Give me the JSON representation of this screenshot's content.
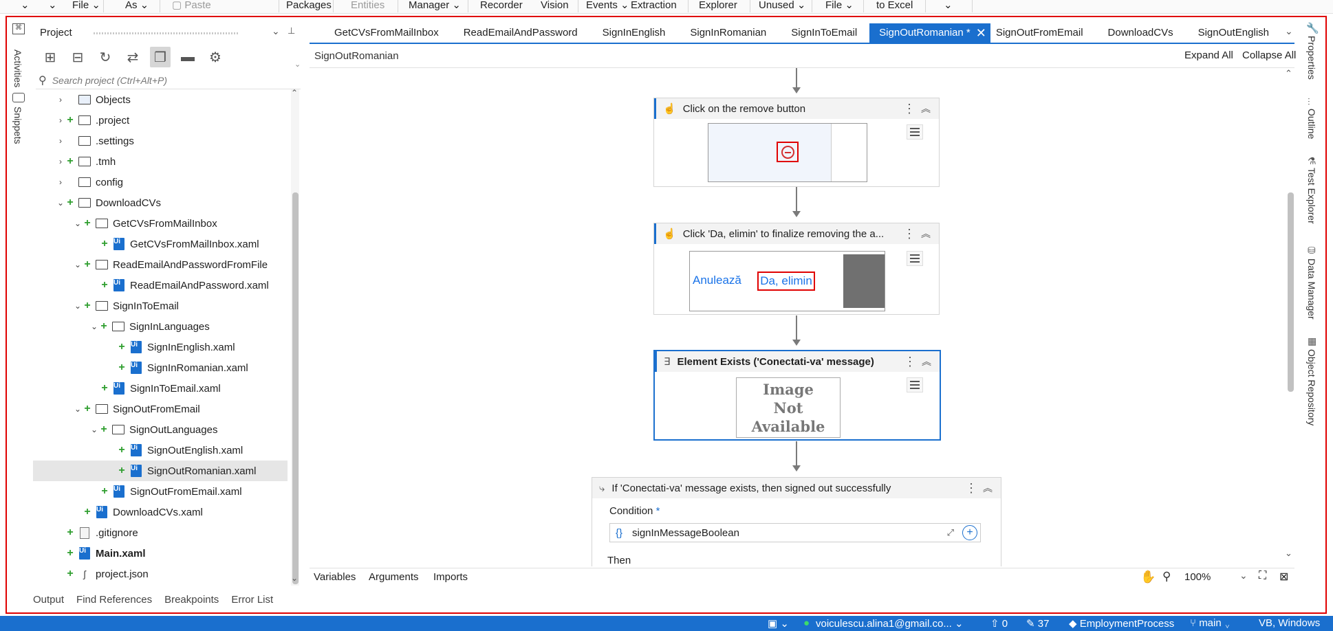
{
  "ribbon": {
    "items": [
      "File",
      "As",
      "Paste",
      "Packages",
      "Entities",
      "Manager",
      "Recorder",
      "Vision",
      "Events",
      "Extraction",
      "Explorer",
      "Unused",
      "File",
      "to Excel"
    ]
  },
  "left_rail": {
    "activities": "Activities",
    "snippets": "Snippets"
  },
  "project_panel": {
    "title": "Project",
    "search_placeholder": "Search project (Ctrl+Alt+P)",
    "tree": [
      {
        "label": "Objects"
      },
      {
        "label": ".project"
      },
      {
        "label": ".settings"
      },
      {
        "label": ".tmh"
      },
      {
        "label": "config"
      },
      {
        "label": "DownloadCVs"
      },
      {
        "label": "GetCVsFromMailInbox"
      },
      {
        "label": "GetCVsFromMailInbox.xaml"
      },
      {
        "label": "ReadEmailAndPasswordFromFile"
      },
      {
        "label": "ReadEmailAndPassword.xaml"
      },
      {
        "label": "SignInToEmail"
      },
      {
        "label": "SignInLanguages"
      },
      {
        "label": "SignInEnglish.xaml"
      },
      {
        "label": "SignInRomanian.xaml"
      },
      {
        "label": "SignInToEmail.xaml"
      },
      {
        "label": "SignOutFromEmail"
      },
      {
        "label": "SignOutLanguages"
      },
      {
        "label": "SignOutEnglish.xaml"
      },
      {
        "label": "SignOutRomanian.xaml"
      },
      {
        "label": "SignOutFromEmail.xaml"
      },
      {
        "label": "DownloadCVs.xaml"
      },
      {
        "label": ".gitignore"
      },
      {
        "label": "Main.xaml"
      },
      {
        "label": "project.json"
      }
    ]
  },
  "bottom_tabs": [
    "Output",
    "Find References",
    "Breakpoints",
    "Error List"
  ],
  "doc_tabs": [
    "GetCVsFromMailInbox",
    "ReadEmailAndPassword",
    "SignInEnglish",
    "SignInRomanian",
    "SignInToEmail",
    "SignOutRomanian *",
    "SignOutFromEmail",
    "DownloadCVs",
    "SignOutEnglish"
  ],
  "designer": {
    "breadcrumb": "SignOutRomanian",
    "expand_all": "Expand All",
    "collapse_all": "Collapse All",
    "activities": [
      {
        "title": "Click on the remove button"
      },
      {
        "title": "Click 'Da, elimin' to finalize removing the a..."
      },
      {
        "title": "Element Exists ('Conectati-va' message)"
      },
      {
        "title": "If 'Conectati-va' message exists, then signed out successfully"
      }
    ],
    "cancel_text": "Anulează",
    "confirm_text": "Da, elimin",
    "image_unavailable": [
      "Image",
      "Not",
      "Available"
    ],
    "condition_label": "Condition",
    "condition_required": "*",
    "condition_value": "signInMessageBoolean",
    "then_label": "Then",
    "bottom_tabs": [
      "Variables",
      "Arguments",
      "Imports"
    ],
    "zoom": "100%"
  },
  "right_rail": [
    "Properties",
    "Outline",
    "Test Explorer",
    "Data Manager",
    "Object Repository"
  ],
  "status_bar": {
    "account": "voiculescu.alina1@gmail.co...",
    "pushes": "0",
    "edits": "37",
    "repo": "EmploymentProcess",
    "branch": "main",
    "lang": "VB, Windows"
  },
  "colors": {
    "accent": "#1a6fce",
    "frame_red": "#e00000",
    "link_blue": "#1a73e8"
  }
}
